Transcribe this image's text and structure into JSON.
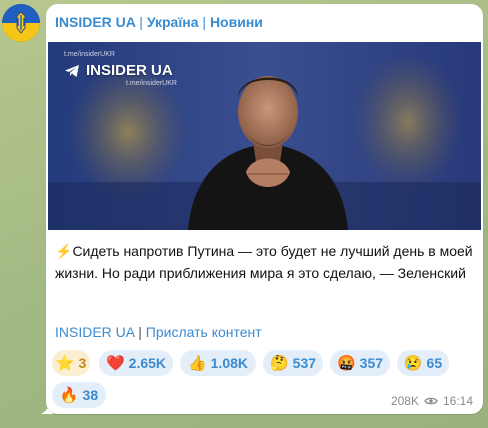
{
  "channel": {
    "name": "INSIDER UA",
    "separator": "|",
    "subtitle_1": "Україна",
    "subtitle_2": "Новини"
  },
  "photo": {
    "logo_text": "INSIDER UA",
    "watermark_top": "t.me/insiderUKR",
    "watermark_bottom": "t.me/insiderUKR",
    "icon": "telegram-icon"
  },
  "post": {
    "lead_icon": "lightning-icon",
    "text": "Сидеть напротив Путина — это будет не лучший день в моей жизни. Но ради приближения мира я это сделаю, — Зеленский"
  },
  "links": {
    "channel_link": "INSIDER UA",
    "separator": "|",
    "submit_link": "Прислать контент"
  },
  "reactions": [
    {
      "emoji": "⭐",
      "count": "3",
      "name": "stars"
    },
    {
      "emoji": "❤️",
      "count": "2.65K",
      "name": "heart"
    },
    {
      "emoji": "👍",
      "count": "1.08K",
      "name": "thumbs-up"
    },
    {
      "emoji": "🤔",
      "count": "537",
      "name": "thinking"
    },
    {
      "emoji": "🤬",
      "count": "357",
      "name": "angry"
    },
    {
      "emoji": "😢",
      "count": "65",
      "name": "crying"
    },
    {
      "emoji": "🔥",
      "count": "38",
      "name": "fire"
    }
  ],
  "meta": {
    "views": "208K",
    "views_icon": "eye-icon",
    "time": "16:14"
  },
  "colors": {
    "accent": "#3a8bd0",
    "bubble": "#ffffff",
    "reaction_bg": "#e3eef9",
    "stars_bg": "#fbefcf"
  }
}
